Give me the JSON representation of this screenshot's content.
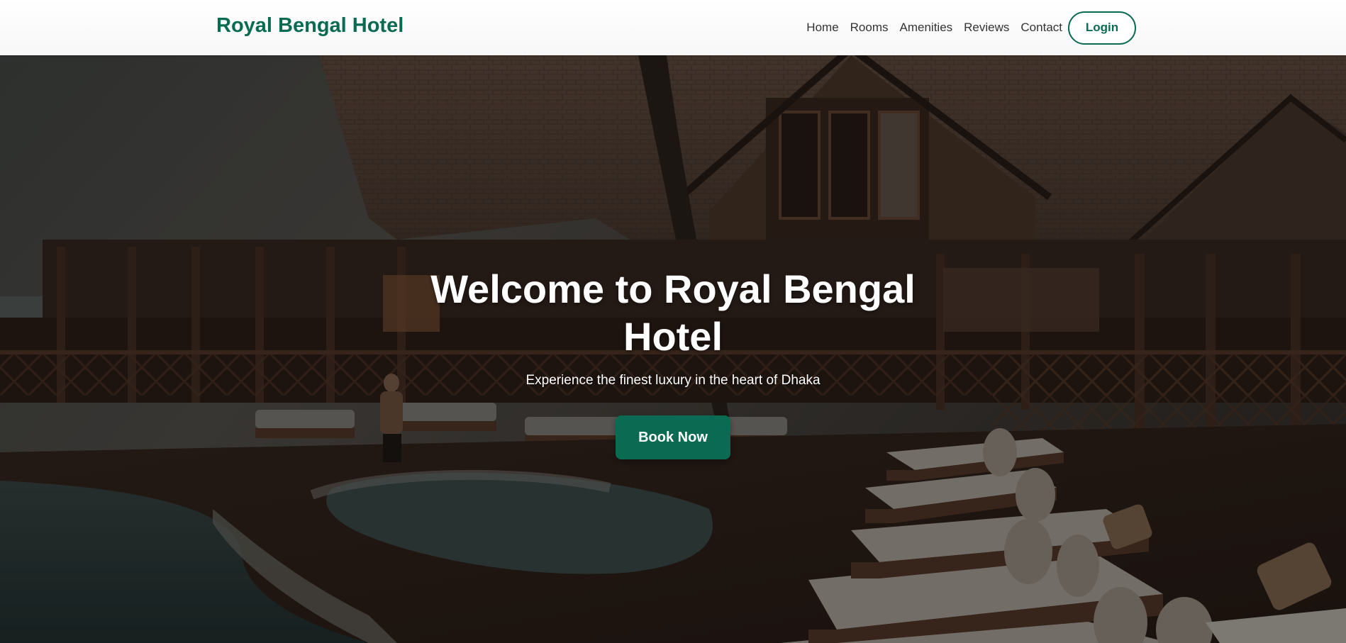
{
  "header": {
    "brand": "Royal Bengal Hotel",
    "nav": [
      "Home",
      "Rooms",
      "Amenities",
      "Reviews",
      "Contact"
    ],
    "login_label": "Login"
  },
  "hero": {
    "title": "Welcome to Royal Bengal Hotel",
    "subtitle": "Experience the finest luxury in the heart of Dhaka",
    "cta_label": "Book Now"
  },
  "colors": {
    "accent": "#0b6b52"
  }
}
